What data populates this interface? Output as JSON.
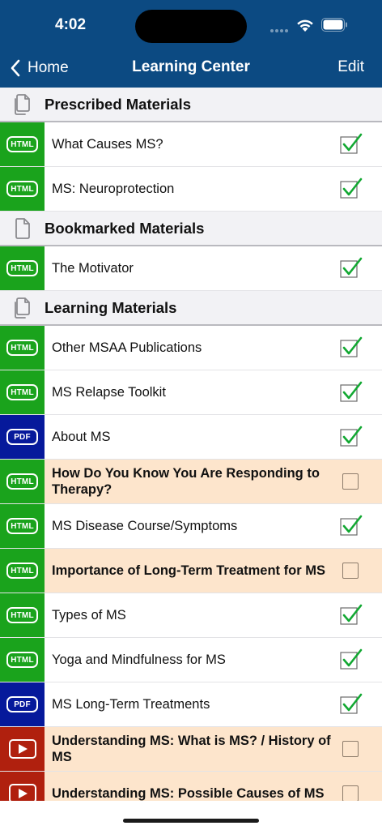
{
  "status_bar": {
    "time": "4:02"
  },
  "nav": {
    "back_label": "Home",
    "title": "Learning Center",
    "edit_label": "Edit"
  },
  "colors": {
    "nav_bg": "#0c4a82",
    "html": "#1aa31c",
    "pdf": "#06199b",
    "video": "#b0200e",
    "unread_bg": "#fde5cc",
    "check": "#12a832"
  },
  "sections": [
    {
      "title": "Prescribed Materials",
      "icon": "documents-icon",
      "items": [
        {
          "type": "html",
          "badge": "HTML",
          "title": "What Causes MS?",
          "done": true
        },
        {
          "type": "html",
          "badge": "HTML",
          "title": "MS: Neuroprotection",
          "done": true
        }
      ]
    },
    {
      "title": "Bookmarked Materials",
      "icon": "document-icon",
      "items": [
        {
          "type": "html",
          "badge": "HTML",
          "title": "The Motivator",
          "done": true
        }
      ]
    },
    {
      "title": "Learning Materials",
      "icon": "documents-icon",
      "items": [
        {
          "type": "html",
          "badge": "HTML",
          "title": "Other MSAA Publications",
          "done": true
        },
        {
          "type": "html",
          "badge": "HTML",
          "title": "MS Relapse Toolkit",
          "done": true
        },
        {
          "type": "pdf",
          "badge": "PDF",
          "title": "About MS",
          "done": true
        },
        {
          "type": "html",
          "badge": "HTML",
          "title": "How Do You Know You Are Responding to Therapy?",
          "done": false
        },
        {
          "type": "html",
          "badge": "HTML",
          "title": "MS Disease Course/Symptoms",
          "done": true
        },
        {
          "type": "html",
          "badge": "HTML",
          "title": "Importance of Long-Term Treatment for MS",
          "done": false
        },
        {
          "type": "html",
          "badge": "HTML",
          "title": "Types of MS",
          "done": true
        },
        {
          "type": "html",
          "badge": "HTML",
          "title": " Yoga and Mindfulness for MS",
          "done": true
        },
        {
          "type": "pdf",
          "badge": "PDF",
          "title": "MS Long-Term Treatments",
          "done": true
        },
        {
          "type": "video",
          "badge": "play-video-icon",
          "title": "Understanding MS: What is MS? / History of MS",
          "done": false
        },
        {
          "type": "video",
          "badge": "play-video-icon",
          "title": "Understanding MS: Possible Causes of MS",
          "done": false
        }
      ]
    }
  ]
}
